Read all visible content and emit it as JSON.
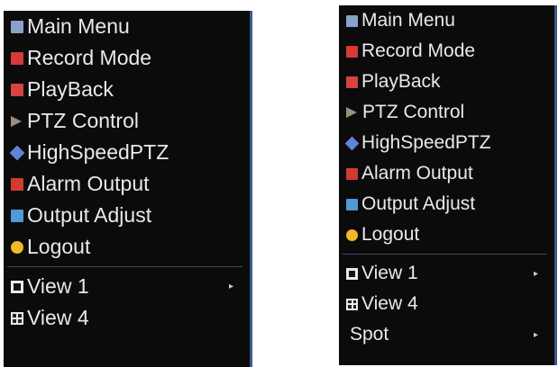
{
  "left_menu": {
    "items": [
      {
        "label": "Main Menu",
        "icon": "main-menu-icon",
        "color": "#8aa0c8"
      },
      {
        "label": "Record Mode",
        "icon": "record-icon",
        "color": "#d63a3a"
      },
      {
        "label": "PlayBack",
        "icon": "playback-icon",
        "color": "#d9433f"
      },
      {
        "label": "PTZ Control",
        "icon": "ptz-icon",
        "color": "#9b8f7d"
      },
      {
        "label": "HighSpeedPTZ",
        "icon": "high-speed-ptz-icon",
        "color": "#5f86d6"
      },
      {
        "label": "Alarm Output",
        "icon": "alarm-icon",
        "color": "#d23b2f"
      },
      {
        "label": "Output Adjust",
        "icon": "output-adjust-icon",
        "color": "#4d9ad8"
      },
      {
        "label": "Logout",
        "icon": "logout-icon",
        "color": "#f0b82a"
      }
    ],
    "views": [
      {
        "label": "View 1",
        "icon": "view-1-icon",
        "submenu": true
      },
      {
        "label": "View 4",
        "icon": "view-4-icon",
        "submenu": false
      }
    ]
  },
  "right_menu": {
    "items": [
      {
        "label": "Main Menu",
        "icon": "main-menu-icon",
        "color": "#8aa0c8"
      },
      {
        "label": "Record Mode",
        "icon": "record-icon",
        "color": "#d63a3a"
      },
      {
        "label": "PlayBack",
        "icon": "playback-icon",
        "color": "#d9433f"
      },
      {
        "label": "PTZ Control",
        "icon": "ptz-icon",
        "color": "#9b8f7d"
      },
      {
        "label": "HighSpeedPTZ",
        "icon": "high-speed-ptz-icon",
        "color": "#5f86d6"
      },
      {
        "label": "Alarm Output",
        "icon": "alarm-icon",
        "color": "#d23b2f"
      },
      {
        "label": "Output Adjust",
        "icon": "output-adjust-icon",
        "color": "#4d9ad8"
      },
      {
        "label": "Logout",
        "icon": "logout-icon",
        "color": "#f0b82a"
      }
    ],
    "views": [
      {
        "label": "View 1",
        "icon": "view-1-icon",
        "submenu": true
      },
      {
        "label": "View 4",
        "icon": "view-4-icon",
        "submenu": false
      },
      {
        "label": "Spot",
        "icon": "",
        "submenu": true
      }
    ]
  },
  "submenu_arrow": "▸"
}
